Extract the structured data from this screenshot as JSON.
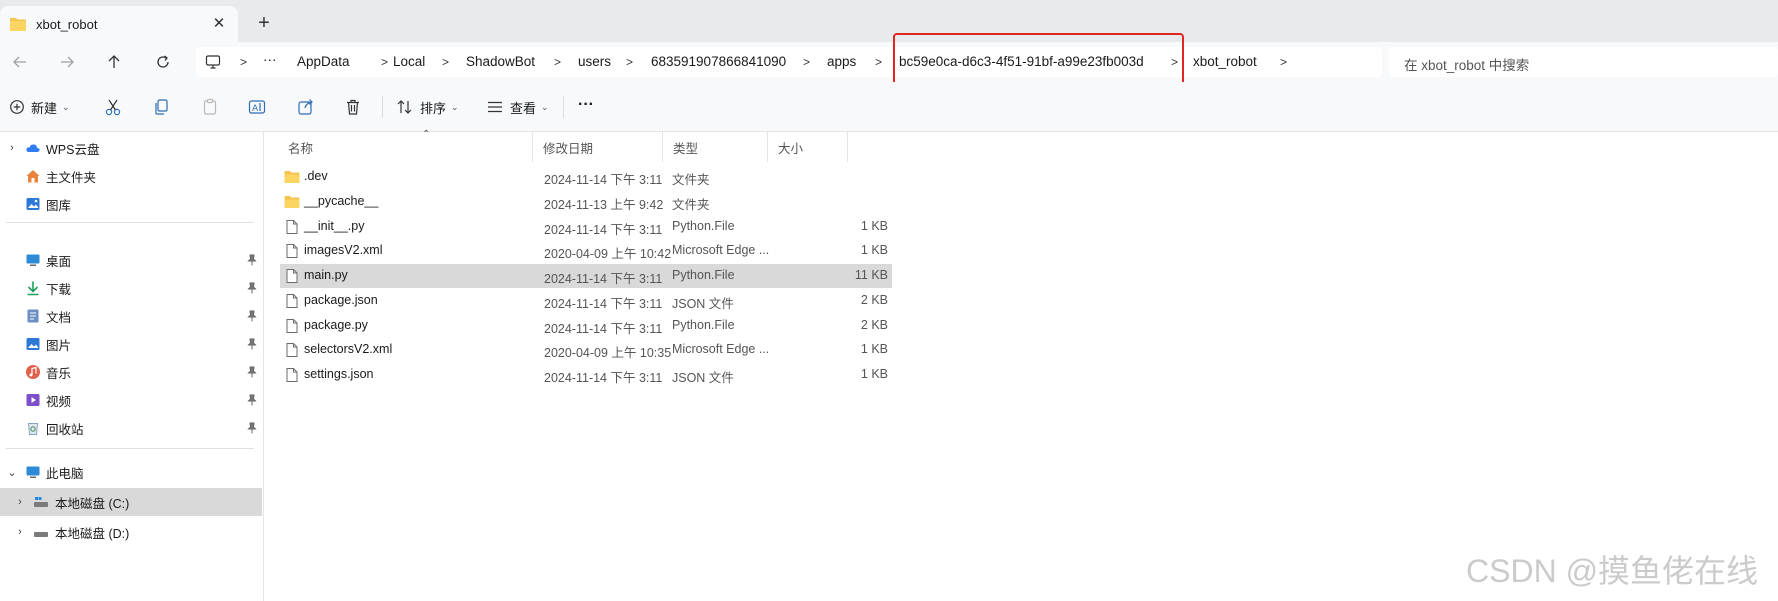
{
  "window": {
    "tab_title": "xbot_robot",
    "tab_close": "✕",
    "new_tab": "+"
  },
  "addressbar": {
    "more": "···",
    "crumbs": [
      "AppData",
      "Local",
      "ShadowBot",
      "users",
      "683591907866841090",
      "apps",
      "bc59e0ca-d6c3-4f51-91bf-a99e23fb003d",
      "xbot_robot"
    ],
    "search_placeholder": "在 xbot_robot 中搜索",
    "highlight_color": "#e0261f"
  },
  "toolbar": {
    "new_label": "新建",
    "sort_label": "排序",
    "view_label": "查看",
    "more_label": "···"
  },
  "sidebar": {
    "items": [
      {
        "label": "WPS云盘",
        "icon": "cloud-icon"
      },
      {
        "label": "主文件夹",
        "icon": "home-icon"
      },
      {
        "label": "图库",
        "icon": "gallery-icon"
      },
      {
        "label": "桌面",
        "icon": "desktop-icon"
      },
      {
        "label": "下载",
        "icon": "download-icon"
      },
      {
        "label": "文档",
        "icon": "documents-icon"
      },
      {
        "label": "图片",
        "icon": "pictures-icon"
      },
      {
        "label": "音乐",
        "icon": "music-icon"
      },
      {
        "label": "视频",
        "icon": "video-icon"
      },
      {
        "label": "回收站",
        "icon": "recycle-bin-icon"
      },
      {
        "label": "此电脑",
        "icon": "this-pc-icon"
      },
      {
        "label": "本地磁盘 (C:)",
        "icon": "drive-icon"
      },
      {
        "label": "本地磁盘 (D:)",
        "icon": "drive-icon"
      }
    ]
  },
  "filelist": {
    "headers": {
      "name": "名称",
      "date": "修改日期",
      "type": "类型",
      "size": "大小"
    },
    "sort_arrow": "⌃",
    "rows": [
      {
        "name": ".dev",
        "date": "2024-11-14 下午 3:11",
        "type": "文件夹",
        "size": "",
        "kind": "folder"
      },
      {
        "name": "__pycache__",
        "date": "2024-11-13 上午 9:42",
        "type": "文件夹",
        "size": "",
        "kind": "folder"
      },
      {
        "name": "__init__.py",
        "date": "2024-11-14 下午 3:11",
        "type": "Python.File",
        "size": "1 KB",
        "kind": "file"
      },
      {
        "name": "imagesV2.xml",
        "date": "2020-04-09 上午 10:42",
        "type": "Microsoft Edge ...",
        "size": "1 KB",
        "kind": "file"
      },
      {
        "name": "main.py",
        "date": "2024-11-14 下午 3:11",
        "type": "Python.File",
        "size": "11 KB",
        "kind": "file"
      },
      {
        "name": "package.json",
        "date": "2024-11-14 下午 3:11",
        "type": "JSON 文件",
        "size": "2 KB",
        "kind": "file"
      },
      {
        "name": "package.py",
        "date": "2024-11-14 下午 3:11",
        "type": "Python.File",
        "size": "2 KB",
        "kind": "file"
      },
      {
        "name": "selectorsV2.xml",
        "date": "2020-04-09 上午 10:35",
        "type": "Microsoft Edge ...",
        "size": "1 KB",
        "kind": "file"
      },
      {
        "name": "settings.json",
        "date": "2024-11-14 下午 3:11",
        "type": "JSON 文件",
        "size": "1 KB",
        "kind": "file"
      }
    ]
  },
  "watermark": "CSDN @摸鱼佬在线"
}
